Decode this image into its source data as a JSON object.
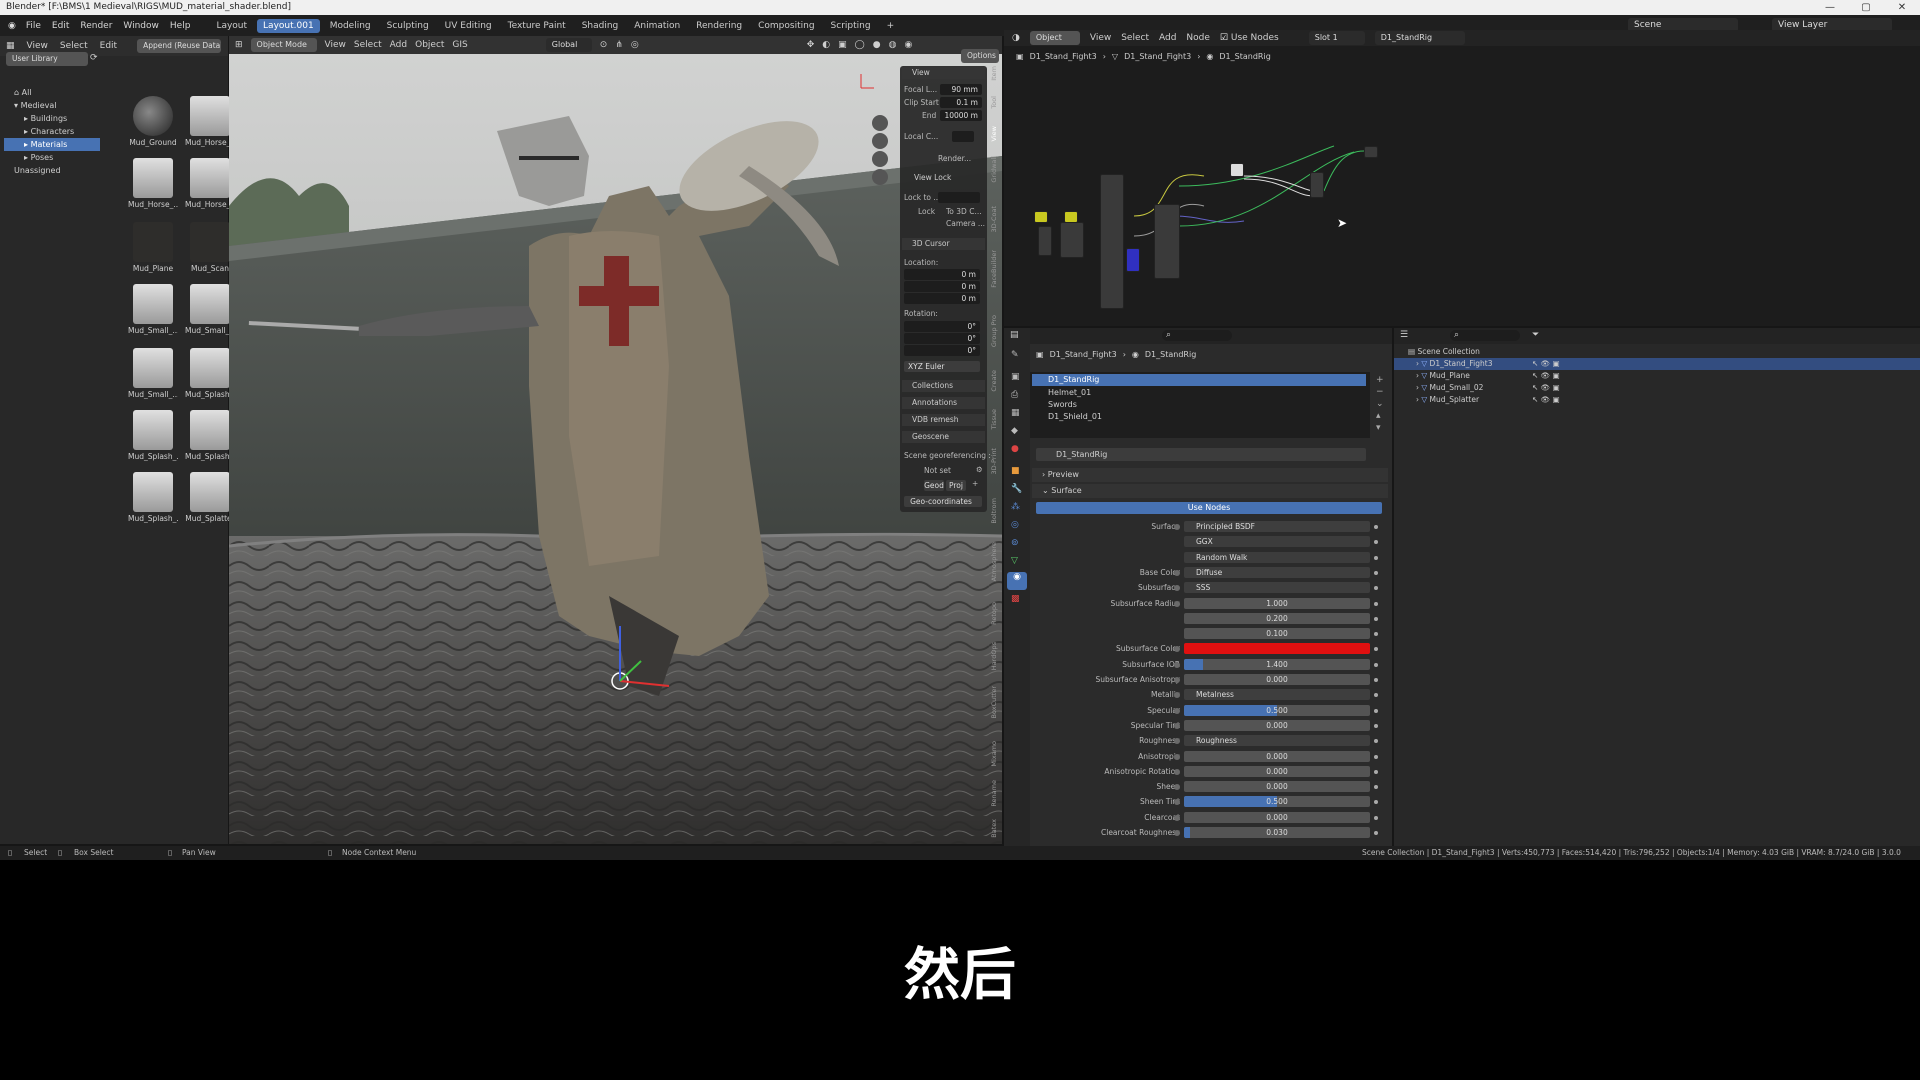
{
  "window_title": "Blender* [F:\\BMS\\1 Medieval\\RIGS\\MUD_material_shader.blend]",
  "menu": [
    "File",
    "Edit",
    "Render",
    "Window",
    "Help"
  ],
  "workspaces": [
    "Layout",
    "Layout.001",
    "Modeling",
    "Sculpting",
    "UV Editing",
    "Texture Paint",
    "Shading",
    "Animation",
    "Rendering",
    "Compositing",
    "Scripting"
  ],
  "active_workspace": "Layout.001",
  "scene_label": "Scene",
  "view_layer_label": "View Layer",
  "asset_browser": {
    "menus": [
      "View",
      "Select",
      "Edit"
    ],
    "import_mode": "Append (Reuse Data)",
    "library": "User Library",
    "tree": [
      {
        "label": "All",
        "level": 0
      },
      {
        "label": "Medieval",
        "level": 0
      },
      {
        "label": "Buildings",
        "level": 1
      },
      {
        "label": "Characters",
        "level": 1
      },
      {
        "label": "Materials",
        "level": 1,
        "selected": true
      },
      {
        "label": "Poses",
        "level": 1
      },
      {
        "label": "Unassigned",
        "level": 0
      }
    ],
    "assets": [
      "Mud_Ground",
      "Mud_Horse_...",
      "Mud_Horse_...",
      "Mud_Horse_...",
      "Mud_Plane",
      "Mud_Scan",
      "Mud_Small_...",
      "Mud_Small_...",
      "Mud_Small_...",
      "Mud_Splash_...",
      "Mud_Splash_...",
      "Mud_Splash_...",
      "Mud_Splash_...",
      "Mud_Splatter"
    ]
  },
  "viewport": {
    "mode": "Object Mode",
    "menus": [
      "View",
      "Select",
      "Add",
      "Object",
      "GIS"
    ],
    "orientation": "Global",
    "options": "Options",
    "npanel": {
      "view_header": "View",
      "focal_label": "Focal L...",
      "focal_value": "90 mm",
      "clip_start_label": "Clip Start",
      "clip_start_value": "0.1 m",
      "end_label": "End",
      "end_value": "10000 m",
      "local_cam_label": "Local C...",
      "render_label": "Render...",
      "view_lock_header": "View Lock",
      "lock_to_label": "Lock to ...",
      "lock_label": "Lock",
      "to_3d_cursor": "To 3D C...",
      "camera_label": "Camera ...",
      "cursor_header": "3D Cursor",
      "location_label": "Location:",
      "loc_x": "0 m",
      "loc_y": "0 m",
      "loc_z": "0 m",
      "rotation_label": "Rotation:",
      "rot_x": "0°",
      "rot_y": "0°",
      "rot_z": "0°",
      "rot_mode": "XYZ Euler",
      "collections": "Collections",
      "annotations": "Annotations",
      "vdb": "VDB remesh",
      "geoscene": "Geoscene",
      "georef_label": "Scene georeferencing :",
      "not_set": "Not set",
      "geod": "Geod",
      "proj": "Proj",
      "geo_coords": "Geo-coordinates"
    },
    "side_tabs": [
      "Item",
      "Tool",
      "View",
      "Gridwall",
      "3D-Coat",
      "FaceBuilder",
      "Group Pro",
      "Create",
      "Tissue",
      "3D-Print",
      "Boltrom",
      "Atmosphere",
      "Retopo",
      "HardOps",
      "BoxCutter",
      "Mixamo",
      "Rename",
      "Batex",
      "Scatter5",
      "MACHIN3"
    ]
  },
  "node_editor": {
    "object_mode": "Object",
    "menus": [
      "View",
      "Select",
      "Add",
      "Node"
    ],
    "use_nodes": "Use Nodes",
    "slot": "Slot 1",
    "material": "D1_StandRig",
    "breadcrumb": [
      "D1_Stand_Fight3",
      "D1_Stand_Fight3",
      "D1_StandRig"
    ]
  },
  "properties": {
    "breadcrumb": [
      "D1_Stand_Fight3",
      "D1_StandRig"
    ],
    "material_slots": [
      "D1_StandRig",
      "Helmet_01",
      "Swords",
      "D1_Shield_01"
    ],
    "material_name": "D1_StandRig",
    "preview": "Preview",
    "surface_header": "Surface",
    "use_nodes": "Use Nodes",
    "rows": [
      {
        "label": "Surface",
        "value": "Principled BSDF",
        "kind": "link"
      },
      {
        "label": "",
        "value": "GGX",
        "kind": "enum"
      },
      {
        "label": "",
        "value": "Random Walk",
        "kind": "enum"
      },
      {
        "label": "Base Color",
        "value": "Diffuse",
        "kind": "link"
      },
      {
        "label": "Subsurface",
        "value": "SSS",
        "kind": "link"
      },
      {
        "label": "Subsurface Radius",
        "value": "1.000",
        "kind": "num"
      },
      {
        "label": "",
        "value": "0.200",
        "kind": "num"
      },
      {
        "label": "",
        "value": "0.100",
        "kind": "num"
      },
      {
        "label": "Subsurface Color",
        "value": "",
        "kind": "color",
        "color": "#e01010"
      },
      {
        "label": "Subsurface IOR",
        "value": "1.400",
        "kind": "slider",
        "fill": 0.1
      },
      {
        "label": "Subsurface Anisotropy",
        "value": "0.000",
        "kind": "num"
      },
      {
        "label": "Metallic",
        "value": "Metalness",
        "kind": "link"
      },
      {
        "label": "Specular",
        "value": "0.500",
        "kind": "slider",
        "fill": 0.5
      },
      {
        "label": "Specular Tint",
        "value": "0.000",
        "kind": "num"
      },
      {
        "label": "Roughness",
        "value": "Roughness",
        "kind": "link"
      },
      {
        "label": "Anisotropic",
        "value": "0.000",
        "kind": "num"
      },
      {
        "label": "Anisotropic Rotation",
        "value": "0.000",
        "kind": "num"
      },
      {
        "label": "Sheen",
        "value": "0.000",
        "kind": "num"
      },
      {
        "label": "Sheen Tint",
        "value": "0.500",
        "kind": "slider",
        "fill": 0.5
      },
      {
        "label": "Clearcoat",
        "value": "0.000",
        "kind": "num"
      },
      {
        "label": "Clearcoat Roughness",
        "value": "0.030",
        "kind": "slider",
        "fill": 0.03
      }
    ]
  },
  "outliner": {
    "root": "Scene Collection",
    "items": [
      "D1_Stand_Fight3",
      "Mud_Plane",
      "Mud_Small_02",
      "Mud_Splatter"
    ]
  },
  "statusbar": {
    "select": "Select",
    "box_select": "Box Select",
    "pan_view": "Pan View",
    "context_menu": "Node Context Menu",
    "stats": "Scene Collection | D1_Stand_Fight3 | Verts:450,773 | Faces:514,420 | Tris:796,252 | Objects:1/4 | Memory: 4.03 GiB | VRAM: 8.7/24.0 GiB | 3.0.0"
  },
  "subtitle": "然后"
}
